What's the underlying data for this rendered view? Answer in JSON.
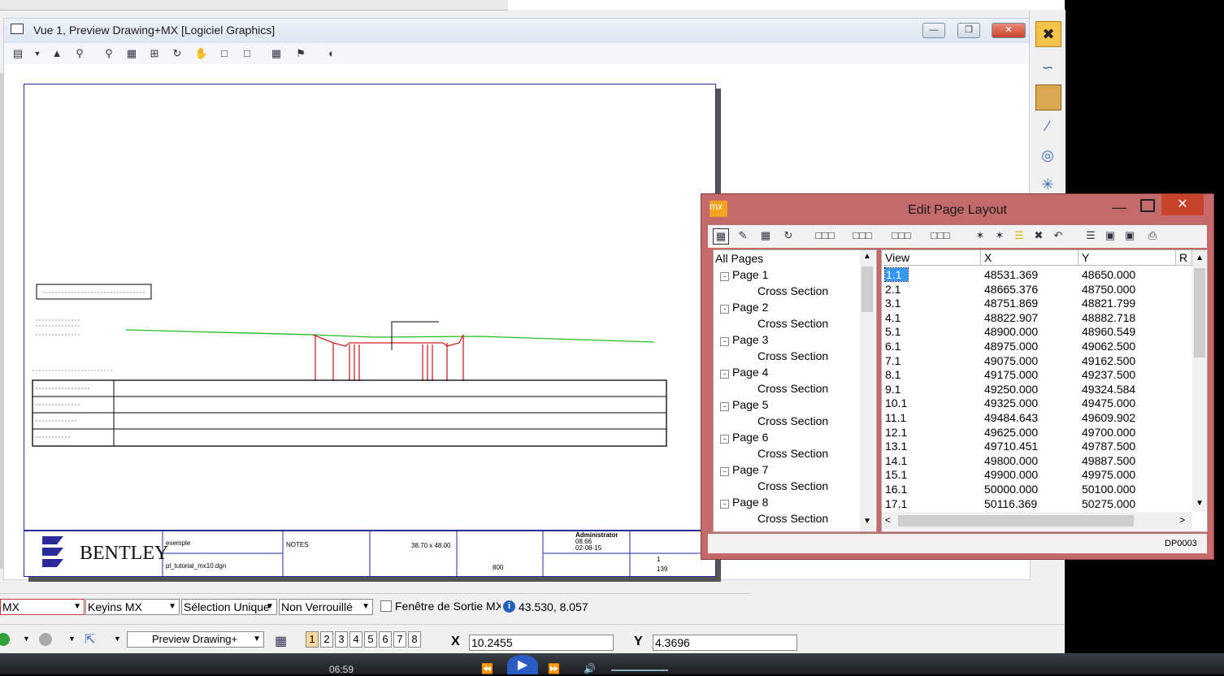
{
  "view_window": {
    "title": "Vue 1, Preview Drawing+MX [Logiciel Graphics]"
  },
  "drawing": {
    "logo_text": "BENTLEY",
    "title_block": {
      "project": "exemple",
      "file": "pl_tutorial_mx10.dgn",
      "notes": "NOTES",
      "scale": "38.70 x 48.00",
      "revision": "800",
      "user": "Administrator",
      "version": "08.66",
      "date": "02-08-15",
      "sheet": "1",
      "of": "139"
    }
  },
  "dialog": {
    "app_icon": "mx",
    "title": "Edit Page Layout",
    "status": "DP0003",
    "tree": {
      "root": "All Pages",
      "pages": [
        {
          "label": "Page 1",
          "child": "Cross Section"
        },
        {
          "label": "Page 2",
          "child": "Cross Section"
        },
        {
          "label": "Page 3",
          "child": "Cross Section"
        },
        {
          "label": "Page 4",
          "child": "Cross Section"
        },
        {
          "label": "Page 5",
          "child": "Cross Section"
        },
        {
          "label": "Page 6",
          "child": "Cross Section"
        },
        {
          "label": "Page 7",
          "child": "Cross Section"
        },
        {
          "label": "Page 8",
          "child": "Cross Section"
        }
      ]
    },
    "grid": {
      "columns": [
        "View",
        "X",
        "Y",
        "R"
      ],
      "rows": [
        {
          "view": "1.1",
          "x": "48531.369",
          "y": "48650.000"
        },
        {
          "view": "2.1",
          "x": "48665.376",
          "y": "48750.000"
        },
        {
          "view": "3.1",
          "x": "48751.869",
          "y": "48821.799"
        },
        {
          "view": "4.1",
          "x": "48822.907",
          "y": "48882.718"
        },
        {
          "view": "5.1",
          "x": "48900.000",
          "y": "48960.549"
        },
        {
          "view": "6.1",
          "x": "48975.000",
          "y": "49062.500"
        },
        {
          "view": "7.1",
          "x": "49075.000",
          "y": "49162.500"
        },
        {
          "view": "8.1",
          "x": "49175.000",
          "y": "49237.500"
        },
        {
          "view": "9.1",
          "x": "49250.000",
          "y": "49324.584"
        },
        {
          "view": "10.1",
          "x": "49325.000",
          "y": "49475.000"
        },
        {
          "view": "11.1",
          "x": "49484.643",
          "y": "49609.902"
        },
        {
          "view": "12.1",
          "x": "49625.000",
          "y": "49700.000"
        },
        {
          "view": "13.1",
          "x": "49710.451",
          "y": "49787.500"
        },
        {
          "view": "14.1",
          "x": "49800.000",
          "y": "49887.500"
        },
        {
          "view": "15.1",
          "x": "49900.000",
          "y": "49975.000"
        },
        {
          "view": "16.1",
          "x": "50000.000",
          "y": "50100.000"
        },
        {
          "view": "17.1",
          "x": "50116.369",
          "y": "50275.000"
        }
      ]
    }
  },
  "bar1": {
    "mx_combo": "MX",
    "keyins_combo": "Keyins MX",
    "selection_combo": "Sélection Unique",
    "lock_combo": "Non Verrouillé",
    "output_window_label": "Fenêtre de Sortie MX",
    "coords": "43.530, 8.057"
  },
  "bar2": {
    "view_combo": "Preview Drawing+",
    "sheets": [
      "1",
      "2",
      "3",
      "4",
      "5",
      "6",
      "7",
      "8"
    ],
    "x_label": "X",
    "x_value": "10.2455",
    "y_label": "Y",
    "y_value": "4.3696"
  },
  "player": {
    "time": "06:59"
  },
  "colors": {
    "dialog_frame": "#c46a6a",
    "close_red": "#c7442a",
    "profile_green": "#22bb22",
    "profile_red": "#cc2222",
    "sheet_blue": "#2a2a9a"
  }
}
